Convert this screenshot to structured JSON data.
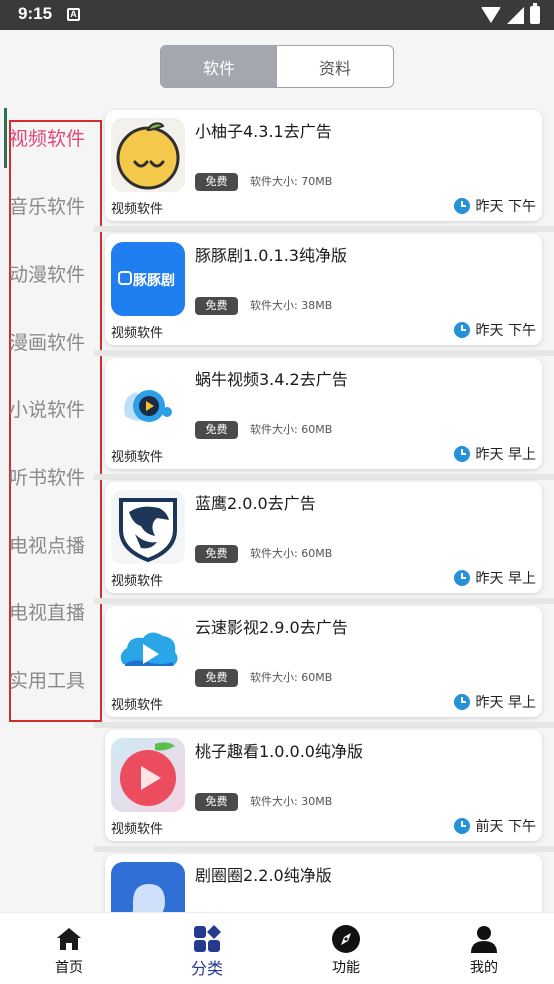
{
  "status_bar": {
    "time": "9:15",
    "notification_glyph": "A"
  },
  "tabs": {
    "active": "软件",
    "inactive": "资料"
  },
  "categories": [
    "视频软件",
    "音乐软件",
    "动漫软件",
    "漫画软件",
    "小说软件",
    "听书软件",
    "电视点播",
    "电视直播",
    "实用工具"
  ],
  "active_category": "视频软件",
  "apps": [
    {
      "name": "小柚子4.3.1去广告",
      "badge": "免费",
      "size": "软件大小: 70MB",
      "category": "视频软件",
      "time": "昨天 下午",
      "icon": "citrus-icon"
    },
    {
      "name": "豚豚剧1.0.1.3纯净版",
      "badge": "免费",
      "size": "软件大小: 38MB",
      "category": "视频软件",
      "time": "昨天 下午",
      "icon": "tuntunju-icon",
      "icon_text": "豚豚剧"
    },
    {
      "name": "蜗牛视频3.4.2去广告",
      "badge": "免费",
      "size": "软件大小: 60MB",
      "category": "视频软件",
      "time": "昨天 早上",
      "icon": "snail-video-icon"
    },
    {
      "name": "蓝鹰2.0.0去广告",
      "badge": "免费",
      "size": "软件大小: 60MB",
      "category": "视频软件",
      "time": "昨天 早上",
      "icon": "eagle-icon"
    },
    {
      "name": "云速影视2.9.0去广告",
      "badge": "免费",
      "size": "软件大小: 60MB",
      "category": "视频软件",
      "time": "昨天 早上",
      "icon": "cloud-play-icon"
    },
    {
      "name": "桃子趣看1.0.0.0纯净版",
      "badge": "免费",
      "size": "软件大小: 30MB",
      "category": "视频软件",
      "time": "前天 下午",
      "icon": "peach-play-icon"
    },
    {
      "name": "剧圈圈2.2.0纯净版",
      "icon": "juquanquan-icon"
    }
  ],
  "bottom_nav": [
    {
      "label": "首页",
      "icon": "home-icon"
    },
    {
      "label": "分类",
      "icon": "category-icon",
      "active": true
    },
    {
      "label": "功能",
      "icon": "compass-icon"
    },
    {
      "label": "我的",
      "icon": "person-icon"
    }
  ],
  "colors": {
    "active_category": "#e0497a",
    "accent_nav": "#243a8f",
    "clock": "#2492d8",
    "tab_active": "#a2a8ae"
  }
}
